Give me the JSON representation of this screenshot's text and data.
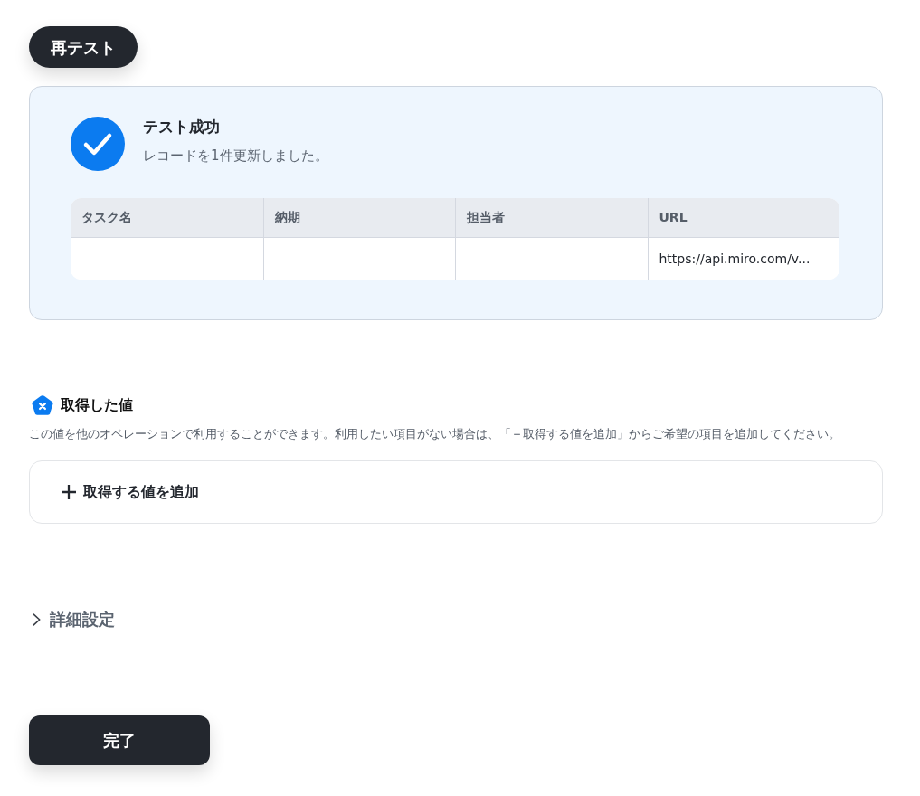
{
  "retest_button": {
    "label": "再テスト"
  },
  "result": {
    "succeeded": true,
    "title": "テスト成功",
    "message": "レコードを1件更新しました。",
    "table": {
      "columns": [
        "タスク名",
        "納期",
        "担当者",
        "URL"
      ],
      "rows": [
        [
          null,
          null,
          null,
          "https://api.miro.com/v..."
        ]
      ]
    }
  },
  "acquired_values": {
    "title": "取得した値",
    "description": "この値を他のオペレーションで利用することができます。利用したい項目がない場合は、「＋取得する値を追加」からご希望の項目を追加してください。",
    "add_button": {
      "label": "取得する値を追加"
    }
  },
  "advanced_settings": {
    "label": "詳細設定",
    "expanded": false
  },
  "done_button": {
    "label": "完了"
  }
}
